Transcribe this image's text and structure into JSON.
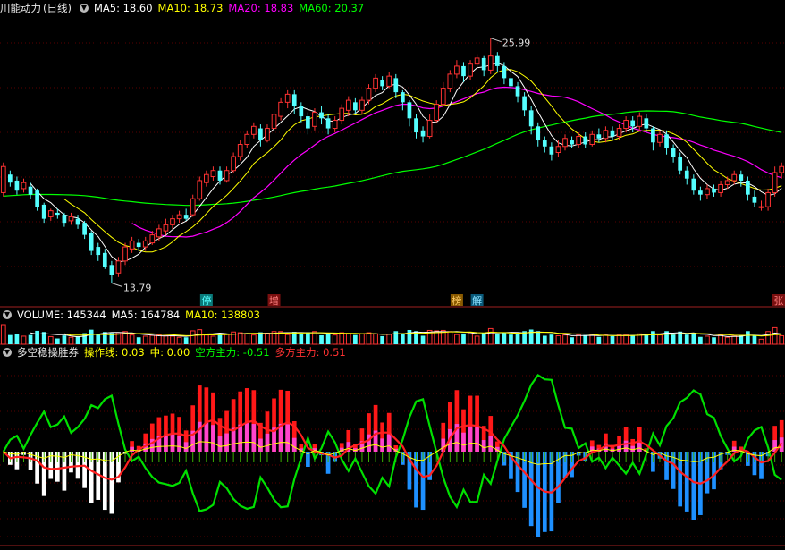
{
  "header": {
    "stock_name": "川能动力",
    "period": "(日线)"
  },
  "colors": {
    "up": "#ff3232",
    "down": "#54ffff",
    "ma5": "#ffffff",
    "ma10": "#ffff00",
    "ma20": "#ff00ff",
    "ma60": "#00ff00",
    "vma5": "#ffffff",
    "vma10": "#ffff00",
    "op_line": "#00e000",
    "mid": "#ffff00",
    "bear": "#ff2020",
    "bull": "#ff2020"
  },
  "legends": {
    "main": [
      {
        "label": "MA5: 18.60",
        "color": "#ffffff"
      },
      {
        "label": "MA10: 18.73",
        "color": "#ffff00"
      },
      {
        "label": "MA20: 18.83",
        "color": "#ff00ff"
      },
      {
        "label": "MA60: 20.37",
        "color": "#00ff00"
      }
    ],
    "volume": [
      {
        "label": "VOLUME: 145344",
        "color": "#ffffff"
      },
      {
        "label": "MA5: 164784",
        "color": "#ffffff"
      },
      {
        "label": "MA10: 138803",
        "color": "#ffff00"
      }
    ],
    "indicator_title": "多空稳操胜券",
    "indicator": [
      {
        "label": "操作线: 0.03",
        "color": "#ffff00"
      },
      {
        "label": "中: 0.00",
        "color": "#ffff00"
      },
      {
        "label": "空方主力: -0.51",
        "color": "#00ff00"
      },
      {
        "label": "多方主力: 0.51",
        "color": "#ff3232"
      }
    ]
  },
  "chart_data": {
    "type": "candlestick",
    "price_high_label": "25.99",
    "price_low_label": "13.79",
    "ylim": [
      13.2,
      27.0
    ],
    "candles": [
      [
        18.3,
        19.6,
        18.1,
        19.8
      ],
      [
        19.2,
        18.8,
        18.6,
        19.4
      ],
      [
        18.9,
        18.4,
        18.2,
        19.1
      ],
      [
        18.5,
        18.8,
        18.3,
        19.0
      ],
      [
        18.6,
        18.2,
        18.0,
        18.8
      ],
      [
        18.4,
        17.6,
        17.4,
        18.5
      ],
      [
        17.7,
        17.0,
        16.8,
        17.8
      ],
      [
        17.1,
        17.4,
        16.9,
        17.5
      ],
      [
        17.3,
        17.2,
        17.0,
        17.5
      ],
      [
        17.2,
        16.8,
        16.6,
        17.3
      ],
      [
        16.9,
        17.1,
        16.7,
        17.3
      ],
      [
        17.0,
        16.7,
        16.5,
        17.2
      ],
      [
        16.8,
        16.2,
        16.0,
        16.9
      ],
      [
        16.3,
        15.4,
        15.2,
        16.4
      ],
      [
        15.6,
        15.2,
        14.9,
        15.8
      ],
      [
        15.3,
        14.6,
        14.5,
        15.5
      ],
      [
        14.7,
        14.2,
        13.8,
        14.9
      ],
      [
        14.3,
        14.9,
        14.1,
        15.1
      ],
      [
        14.9,
        15.6,
        14.7,
        15.8
      ],
      [
        15.5,
        15.9,
        15.3,
        16.1
      ],
      [
        15.8,
        15.6,
        15.4,
        16.0
      ],
      [
        15.6,
        15.9,
        15.4,
        16.1
      ],
      [
        15.8,
        16.2,
        15.7,
        16.4
      ],
      [
        16.1,
        16.5,
        15.9,
        16.7
      ],
      [
        16.4,
        16.7,
        16.2,
        17.0
      ],
      [
        16.7,
        17.0,
        16.5,
        17.2
      ],
      [
        17.0,
        17.2,
        16.8,
        17.4
      ],
      [
        17.2,
        17.0,
        16.9,
        17.5
      ],
      [
        17.2,
        18.0,
        17.1,
        18.2
      ],
      [
        18.0,
        18.9,
        17.9,
        19.1
      ],
      [
        18.8,
        19.2,
        18.6,
        19.4
      ],
      [
        19.1,
        19.4,
        18.9,
        19.6
      ],
      [
        19.4,
        18.9,
        18.7,
        19.6
      ],
      [
        18.9,
        19.4,
        18.8,
        19.6
      ],
      [
        19.4,
        20.1,
        19.3,
        20.3
      ],
      [
        20.1,
        20.7,
        19.9,
        20.9
      ],
      [
        20.7,
        21.2,
        20.5,
        21.4
      ],
      [
        21.2,
        21.6,
        21.0,
        21.8
      ],
      [
        21.5,
        20.9,
        20.6,
        21.7
      ],
      [
        20.9,
        21.5,
        20.8,
        21.7
      ],
      [
        21.5,
        22.2,
        21.3,
        22.4
      ],
      [
        22.1,
        22.8,
        21.9,
        23.0
      ],
      [
        22.8,
        23.2,
        22.5,
        23.4
      ],
      [
        23.2,
        22.6,
        22.2,
        23.4
      ],
      [
        22.6,
        22.1,
        21.8,
        22.8
      ],
      [
        22.1,
        21.5,
        21.2,
        22.3
      ],
      [
        21.6,
        22.3,
        21.4,
        22.5
      ],
      [
        22.3,
        22.0,
        21.7,
        22.6
      ],
      [
        22.0,
        21.5,
        21.2,
        22.2
      ],
      [
        21.5,
        21.9,
        21.3,
        22.1
      ],
      [
        21.9,
        22.5,
        21.7,
        22.7
      ],
      [
        22.4,
        22.9,
        22.1,
        23.1
      ],
      [
        22.8,
        22.4,
        22.2,
        23.0
      ],
      [
        22.4,
        22.9,
        22.2,
        23.1
      ],
      [
        22.9,
        23.5,
        22.7,
        23.7
      ],
      [
        23.5,
        24.0,
        23.3,
        24.2
      ],
      [
        23.9,
        23.6,
        23.4,
        24.1
      ],
      [
        23.6,
        24.1,
        23.5,
        24.3
      ],
      [
        24.0,
        23.3,
        23.0,
        24.2
      ],
      [
        23.3,
        22.8,
        22.4,
        23.4
      ],
      [
        22.8,
        22.0,
        21.6,
        22.9
      ],
      [
        22.0,
        21.3,
        21.0,
        22.2
      ],
      [
        21.4,
        21.1,
        20.8,
        21.6
      ],
      [
        21.1,
        21.9,
        21.0,
        22.2
      ],
      [
        21.9,
        22.7,
        21.8,
        22.9
      ],
      [
        22.7,
        23.5,
        22.6,
        23.8
      ],
      [
        23.5,
        24.2,
        23.3,
        24.4
      ],
      [
        24.2,
        24.6,
        24.0,
        24.9
      ],
      [
        24.6,
        24.1,
        23.8,
        24.8
      ],
      [
        24.1,
        24.7,
        23.9,
        24.9
      ],
      [
        24.7,
        25.0,
        24.5,
        25.2
      ],
      [
        25.0,
        24.4,
        24.1,
        25.1
      ],
      [
        24.4,
        25.1,
        24.2,
        25.99
      ],
      [
        25.1,
        24.6,
        24.3,
        25.3
      ],
      [
        24.6,
        24.0,
        23.7,
        24.8
      ],
      [
        24.0,
        23.6,
        23.3,
        24.2
      ],
      [
        23.6,
        23.1,
        22.8,
        23.8
      ],
      [
        23.1,
        22.4,
        22.1,
        23.3
      ],
      [
        22.4,
        21.6,
        21.2,
        22.6
      ],
      [
        21.6,
        20.9,
        20.6,
        21.8
      ],
      [
        20.9,
        20.6,
        20.3,
        21.1
      ],
      [
        20.6,
        20.2,
        19.9,
        20.8
      ],
      [
        20.3,
        20.6,
        20.1,
        20.9
      ],
      [
        20.6,
        21.0,
        20.4,
        21.2
      ],
      [
        20.9,
        20.7,
        20.5,
        21.1
      ],
      [
        20.7,
        21.1,
        20.5,
        21.3
      ],
      [
        21.1,
        20.7,
        20.5,
        21.3
      ],
      [
        20.7,
        21.2,
        20.6,
        21.4
      ],
      [
        21.2,
        21.0,
        20.8,
        21.5
      ],
      [
        21.0,
        21.4,
        20.8,
        21.6
      ],
      [
        21.4,
        21.1,
        20.9,
        21.6
      ],
      [
        21.1,
        21.5,
        20.9,
        21.7
      ],
      [
        21.5,
        21.9,
        21.3,
        22.1
      ],
      [
        21.9,
        21.6,
        21.3,
        22.1
      ],
      [
        21.6,
        22.1,
        21.4,
        22.3
      ],
      [
        22.0,
        21.5,
        21.3,
        22.2
      ],
      [
        21.5,
        20.8,
        20.4,
        21.6
      ],
      [
        20.8,
        21.2,
        20.6,
        21.4
      ],
      [
        21.2,
        20.5,
        20.2,
        21.4
      ],
      [
        20.5,
        20.1,
        19.8,
        20.7
      ],
      [
        20.1,
        19.4,
        19.2,
        20.3
      ],
      [
        19.4,
        19.0,
        18.7,
        19.6
      ],
      [
        19.0,
        18.4,
        18.2,
        19.2
      ],
      [
        18.4,
        18.2,
        17.9,
        18.6
      ],
      [
        18.2,
        18.5,
        18.0,
        18.7
      ],
      [
        18.5,
        18.3,
        18.1,
        18.7
      ],
      [
        18.3,
        18.7,
        18.1,
        18.9
      ],
      [
        18.7,
        18.9,
        18.5,
        19.1
      ],
      [
        18.9,
        19.2,
        18.7,
        19.4
      ],
      [
        19.2,
        18.9,
        18.6,
        19.4
      ],
      [
        18.9,
        18.2,
        17.9,
        19.1
      ],
      [
        18.1,
        17.8,
        17.6,
        18.4
      ],
      [
        17.6,
        17.6,
        17.4,
        17.9
      ],
      [
        17.6,
        18.3,
        17.4,
        18.5
      ],
      [
        18.3,
        19.3,
        18.1,
        19.6
      ],
      [
        19.3,
        19.6,
        19.0,
        19.8
      ]
    ],
    "badges": [
      {
        "i": 30,
        "text": "停",
        "bg": "#0a7a7a",
        "fg": "#54ffff"
      },
      {
        "i": 40,
        "text": "增",
        "bg": "#7a1010",
        "fg": "#ff8080"
      },
      {
        "i": 67,
        "text": "榜",
        "bg": "#8a5a00",
        "fg": "#ffcc66"
      },
      {
        "i": 70,
        "text": "解",
        "bg": "#0a5a7a",
        "fg": "#8ae0ff"
      },
      {
        "i": 124,
        "text": "张",
        "bg": "#7a1010",
        "fg": "#ff8080"
      }
    ]
  }
}
